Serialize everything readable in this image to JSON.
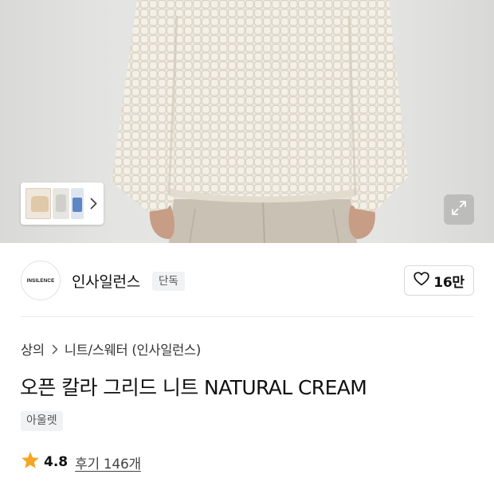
{
  "hero": {
    "gallery_thumbnails": [
      "thumbnail-cream-sweater",
      "thumbnail-grey-model",
      "thumbnail-blue-model"
    ],
    "thumbnail_next_icon": "chevron-right-icon",
    "expand_icon": "expand-arrows-icon"
  },
  "brand": {
    "logo_text": "INSILENCE",
    "name": "인사일런스",
    "badge": "단독",
    "like_icon": "heart-outline-icon",
    "like_count": "16만"
  },
  "product": {
    "breadcrumb": [
      "상의",
      "니트/스웨터 (인사일런스)"
    ],
    "breadcrumb_separator_icon": "chevron-right-icon",
    "title": "오픈 칼라 그리드 니트 NATURAL CREAM",
    "tag": "아울렛",
    "rating_icon": "star-icon",
    "rating": "4.8",
    "reviews_label": "후기 146개"
  },
  "colors": {
    "star": "#f5a623",
    "sweater": "#ece7dc",
    "background": "#e6e6e4",
    "badge_bg": "#f1f2f4"
  }
}
